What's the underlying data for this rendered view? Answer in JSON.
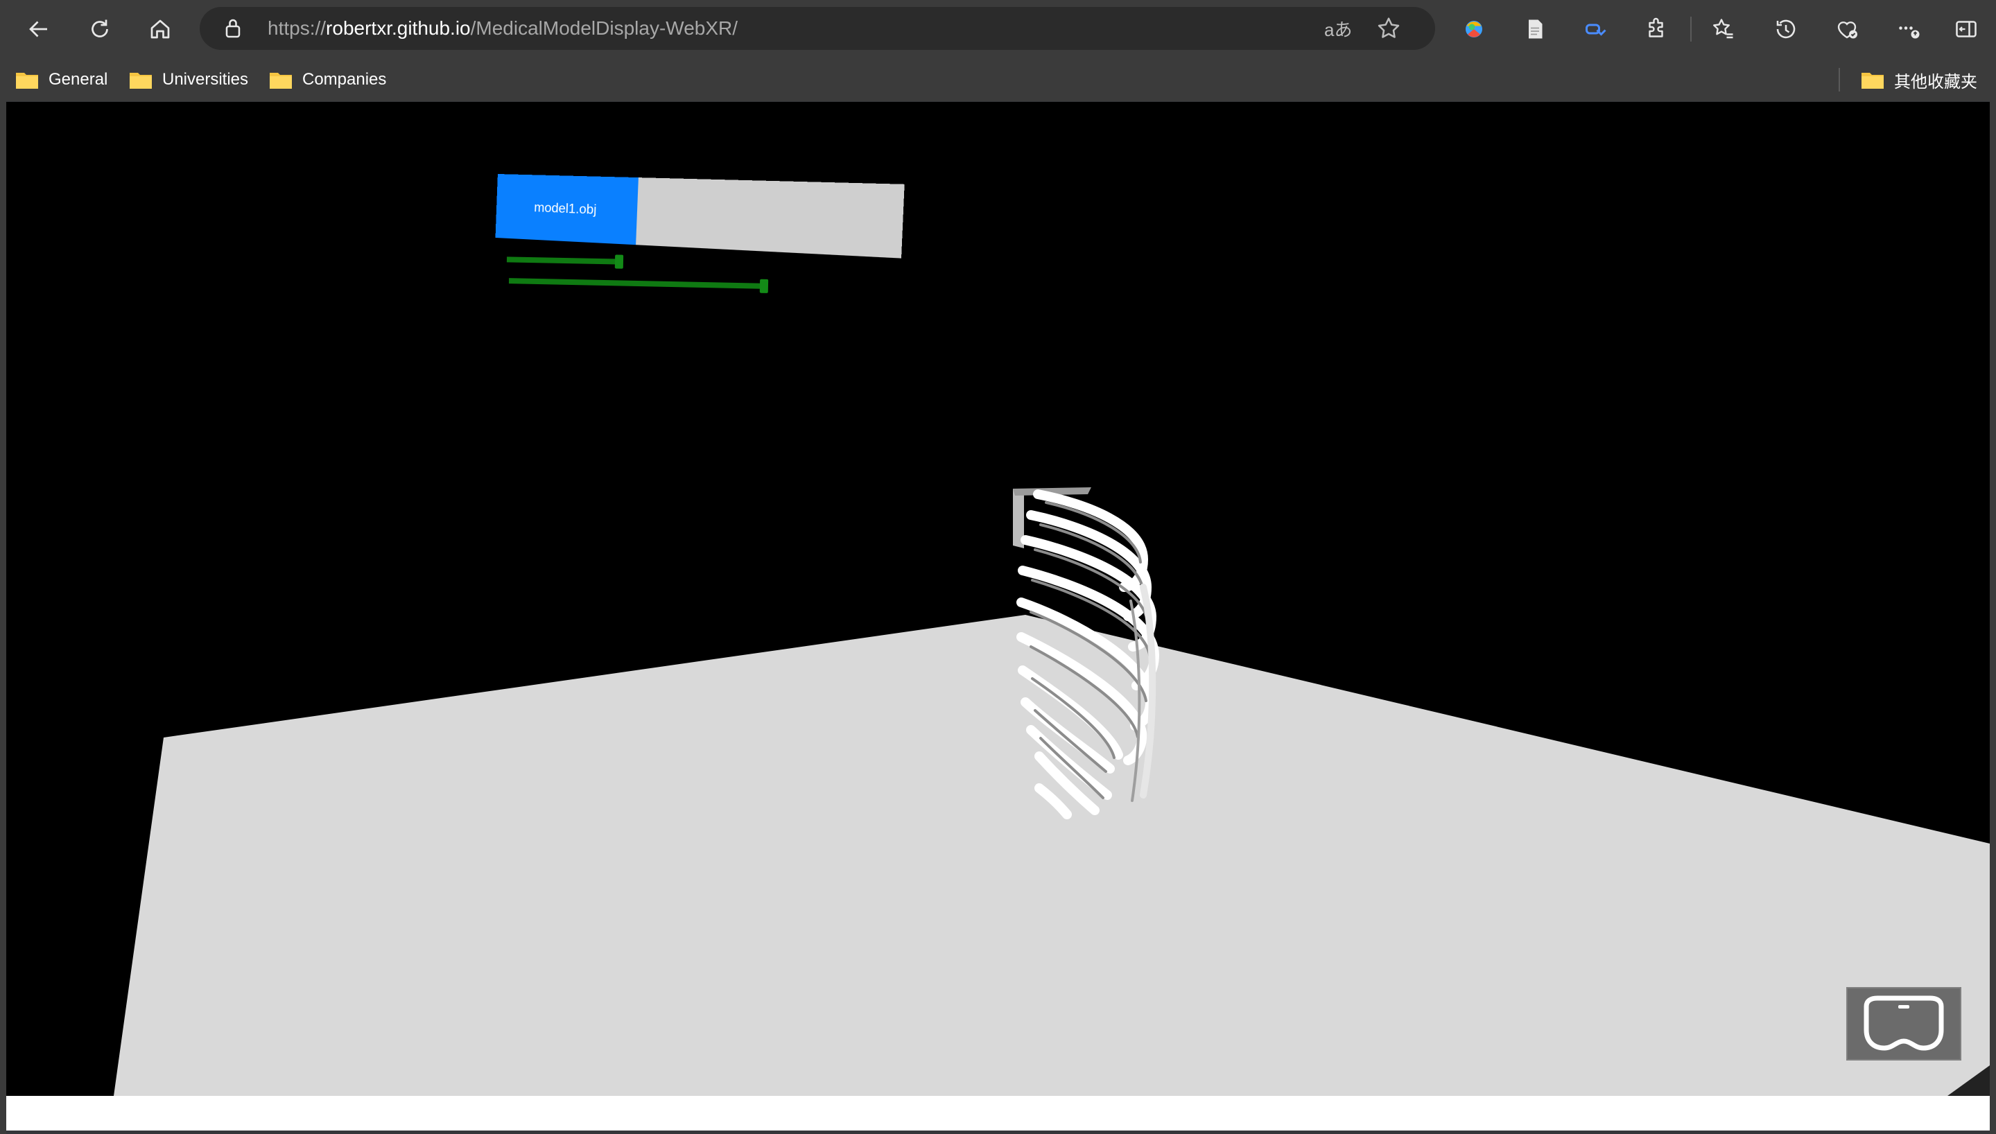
{
  "browser": {
    "url_scheme": "https://",
    "url_host": "robertxr.github.io",
    "url_path": "/MedicalModelDisplay-WebXR/",
    "read_aloud_label": "aあ",
    "toolbar_icons": [
      "back-icon",
      "refresh-icon",
      "home-icon",
      "lock-icon",
      "favorite-star-icon",
      "profile-colorful-icon",
      "page-icon",
      "copilot-icon",
      "extensions-icon",
      "favorites-icon",
      "history-icon",
      "browser-essentials-icon",
      "more-icon",
      "sidebar-icon"
    ]
  },
  "bookmarks": {
    "items": [
      {
        "label": "General"
      },
      {
        "label": "Universities"
      },
      {
        "label": "Companies"
      }
    ],
    "other": "其他收藏夹"
  },
  "scene": {
    "panel_button_label": "model1.obj",
    "sliders": [
      {
        "name": "slider-1",
        "value": 0.42
      },
      {
        "name": "slider-2",
        "value": 0.98
      }
    ],
    "colors": {
      "background": "#000000",
      "floor": "#d9d9d9",
      "button": "#0a80ff",
      "slider": "#0f7a12"
    },
    "vr_button_icon": "vr-headset-icon"
  }
}
